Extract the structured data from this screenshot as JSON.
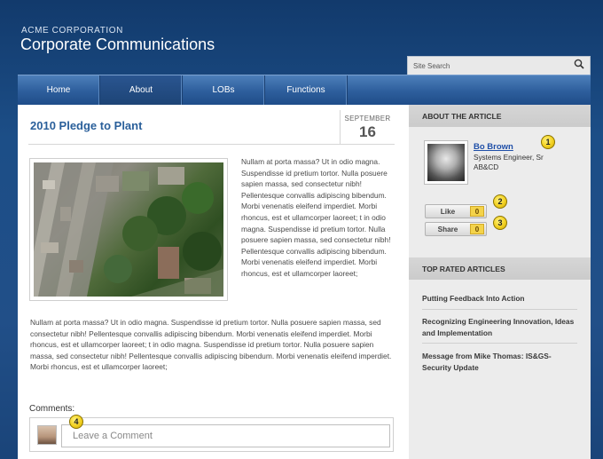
{
  "header": {
    "company": "ACME CORPORATION",
    "title": "Corporate Communications"
  },
  "search": {
    "placeholder": "Site Search"
  },
  "nav": {
    "items": [
      {
        "label": "Home"
      },
      {
        "label": "About"
      },
      {
        "label": "LOBs"
      },
      {
        "label": "Functions"
      }
    ],
    "active": "About"
  },
  "article": {
    "title": "2010 Pledge to Plant",
    "date_month": "SEPTEMBER",
    "date_day": "16",
    "paragraph1": "Nullam at porta massa? Ut in odio magna. Suspendisse id pretium tortor. Nulla posuere sapien massa, sed consectetur nibh! Pellentesque convallis adipiscing bibendum. Morbi venenatis eleifend imperdiet. Morbi rhoncus, est et ullamcorper laoreet; t in odio magna. Suspendisse id pretium tortor. Nulla posuere sapien massa, sed consectetur nibh! Pellentesque convallis adipiscing bibendum. Morbi venenatis eleifend imperdiet. Morbi rhoncus, est et ullamcorper laoreet;",
    "paragraph2": "Nullam at porta massa? Ut in odio magna. Suspendisse id pretium tortor. Nulla posuere sapien massa, sed consectetur nibh! Pellentesque convallis adipiscing bibendum. Morbi venenatis eleifend imperdiet. Morbi rhoncus, est et ullamcorper laoreet; t in odio magna. Suspendisse id pretium tortor. Nulla posuere sapien massa, sed consectetur nibh! Pellentesque convallis adipiscing bibendum. Morbi venenatis eleifend imperdiet. Morbi rhoncus, est et ullamcorper laoreet;"
  },
  "comments": {
    "label": "Comments:",
    "placeholder": "Leave a Comment"
  },
  "sidebar": {
    "about_heading": "ABOUT THE ARTICLE",
    "author": {
      "name": "Bo Brown",
      "role": "Systems Engineer, Sr",
      "org": "AB&CD"
    },
    "like_label": "Like",
    "like_count": "0",
    "share_label": "Share",
    "share_count": "0",
    "top_rated_heading": "TOP RATED ARTICLES",
    "top_rated": [
      "Putting Feedback Into Action",
      "Recognizing Engineering Innovation, Ideas and Implementation",
      "Message from Mike Thomas: IS&GS-Security Update"
    ]
  },
  "callouts": [
    "1",
    "2",
    "3",
    "4"
  ],
  "colors": {
    "background": "#1c4e87",
    "nav": "#2d5e9c",
    "link": "#1f4fa8",
    "title": "#2a5f9a",
    "callout": "#f2d020"
  }
}
